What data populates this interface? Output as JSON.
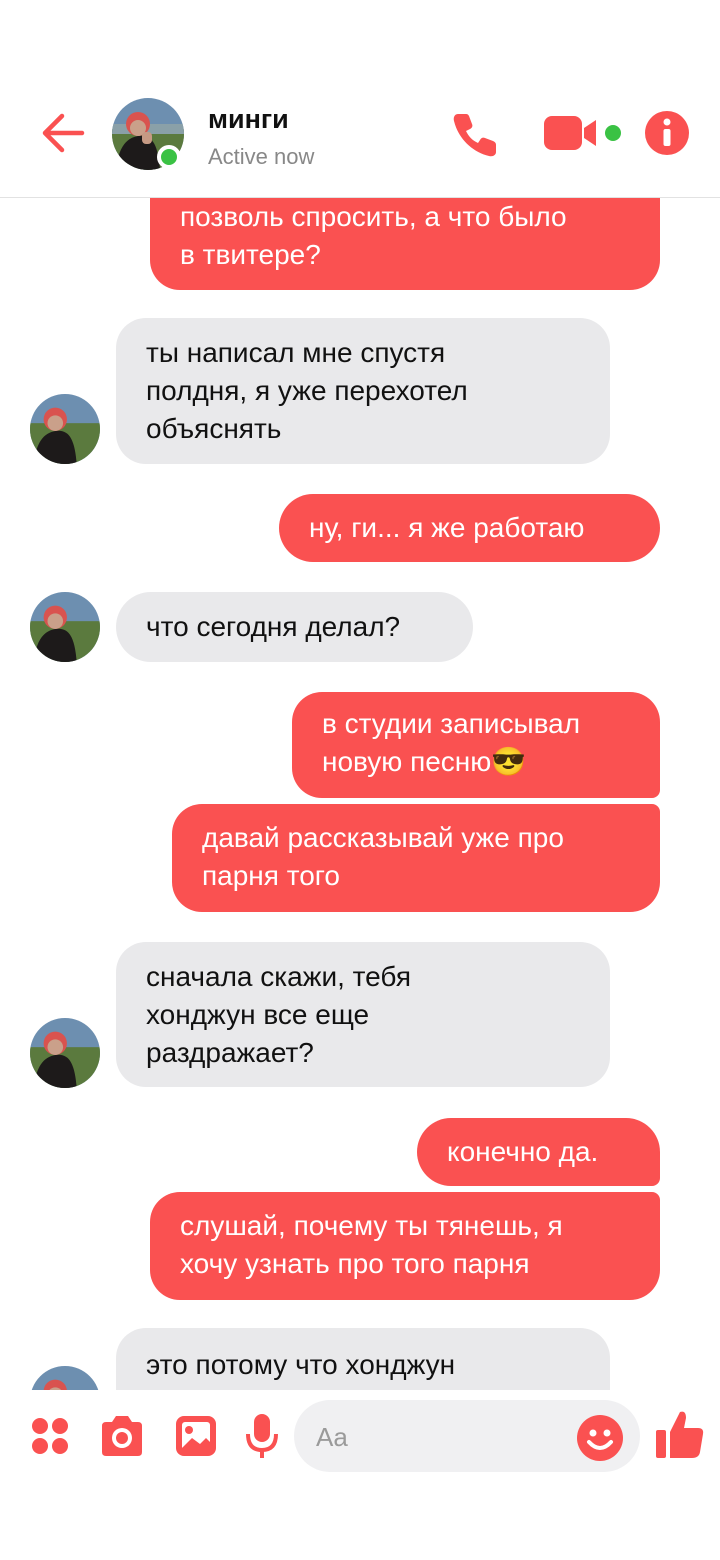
{
  "header": {
    "contact_name": "минги",
    "status": "Active now"
  },
  "messages": [
    {
      "dir": "sent",
      "lines": [
        "позволь спросить, а что было",
        "в твитере?"
      ]
    },
    {
      "dir": "recv",
      "lines": [
        "ты написал мне спустя",
        "полдня, я уже перехотел",
        "объяснять"
      ]
    },
    {
      "dir": "sent",
      "lines": [
        "ну, ги... я же работаю"
      ]
    },
    {
      "dir": "recv",
      "lines": [
        "что сегодня делал?"
      ]
    },
    {
      "dir": "sent",
      "lines": [
        "в студии записывал",
        "новую песню😎"
      ]
    },
    {
      "dir": "sent",
      "lines": [
        "давай рассказывай уже про",
        "парня того"
      ]
    },
    {
      "dir": "recv",
      "lines": [
        "сначала скажи, тебя",
        "хонджун все еще",
        "раздражает?"
      ]
    },
    {
      "dir": "sent",
      "lines": [
        "конечно да."
      ]
    },
    {
      "dir": "sent",
      "lines": [
        "слушай, почему ты тянешь, я",
        "хочу узнать про того парня"
      ]
    },
    {
      "dir": "recv",
      "lines": [
        "это потому что хонджун"
      ]
    }
  ],
  "composer": {
    "placeholder": "Aa"
  },
  "colors": {
    "accent": "#fa5151",
    "received_bubble": "#e9e9eb",
    "online": "#3ac244"
  },
  "icons": [
    "back-arrow-icon",
    "phone-icon",
    "video-camera-icon",
    "info-icon",
    "apps-grid-icon",
    "camera-icon",
    "gallery-icon",
    "microphone-icon",
    "smiley-icon",
    "thumbs-up-icon"
  ]
}
